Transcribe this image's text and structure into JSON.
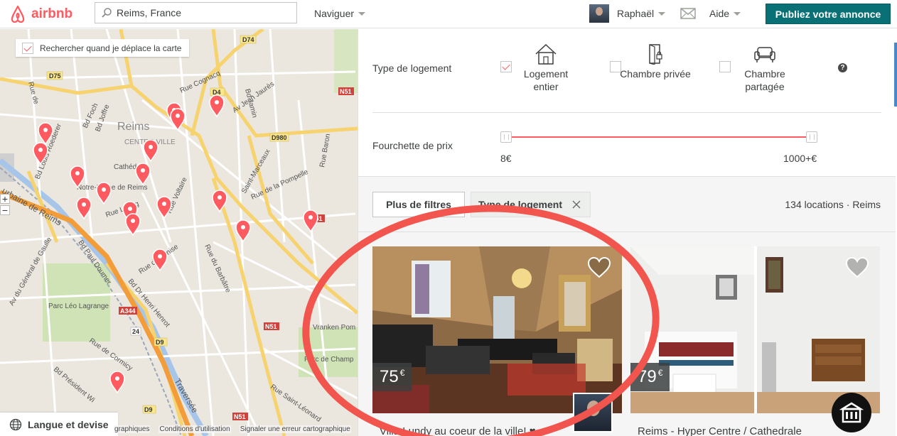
{
  "header": {
    "brand": "airbnb",
    "search_value": "Reims, France",
    "nav_browse": "Naviguer",
    "user_name": "Raphaël",
    "help": "Aide",
    "publish_button": "Publiez votre annonce"
  },
  "map": {
    "search_on_move_label": "Rechercher quand je déplace la carte",
    "search_on_move_checked": true,
    "zoom_in": "+",
    "zoom_out": "−",
    "language_currency": "Langue et devise",
    "footer_links": [
      "graphiques",
      "Conditions d'utilisation",
      "Signaler une erreur cartographique"
    ],
    "pin_color": "#ff5a5f",
    "labels": {
      "city": "Reims",
      "centre": "CENTRE-VILLE",
      "cathedrale": "Cathédrale",
      "notre_dame": "Notre-Dame de Reims",
      "park": "Parc Léo Lagrange",
      "vranken": "Vranken Pom",
      "parc_champagne": "Parc de Champ",
      "bd_joffre": "Bd Joffre",
      "bd_foch": "Bd Foch",
      "bd_louis_roederer": "Bd Louis Roederer",
      "rue_urbaine": "urbaine de Reims",
      "bd_paul_doumer": "Bd Paul Doumer",
      "av_general": "Av du Général de Gaulle",
      "bd_henri": "Bd Dr Henri Henrot",
      "rue_venise": "Rue de Venise",
      "rue_barbatre": "Rue du Barbâtre",
      "rue_pompelle": "Rue de la Pompelle",
      "bd_jamin": "Bd Jamin",
      "av_jaures": "Av Jean Jaurès",
      "rue_baron": "Rue Baron",
      "st_marceaux": "Saint-Marceaux",
      "rue_voltaire": "Rue Voltaire",
      "rue_libergier": "Rue Liberg",
      "traversee": "Traversée",
      "bd_president": "Bd Président Wi",
      "rue_courcy": "Rue de Cormicy",
      "rue_st_leonard": "Rue Saint-Léonard",
      "rue_cognac": "Rue Cognacq",
      "rue_de": "Rue de",
      "d75": "D75",
      "d74": "D74",
      "d980": "D980",
      "d4": "D4",
      "n51": "N51",
      "a344": "A344",
      "d9": "D9",
      "r24": "24"
    }
  },
  "filters": {
    "room_type_label": "Type de logement",
    "room_types": [
      {
        "label": "Logement entier",
        "checked": true
      },
      {
        "label": "Chambre privée",
        "checked": false
      },
      {
        "label": "Chambre partagée",
        "checked": false
      }
    ],
    "help": "?",
    "price_range_label": "Fourchette de prix",
    "price_min": "8€",
    "price_max": "1000+€",
    "more_filters": "Plus de filtres",
    "active_tag": "Type de logement",
    "results_count": "134 locations · Reims",
    "accent": "#ff5a5f"
  },
  "listings": [
    {
      "price": "75",
      "currency": "€",
      "title": "Villa Lundy au coeur de la ville! ♥"
    },
    {
      "price": "79",
      "currency": "€",
      "title": "Reims - Hyper Centre / Cathedrale"
    }
  ]
}
